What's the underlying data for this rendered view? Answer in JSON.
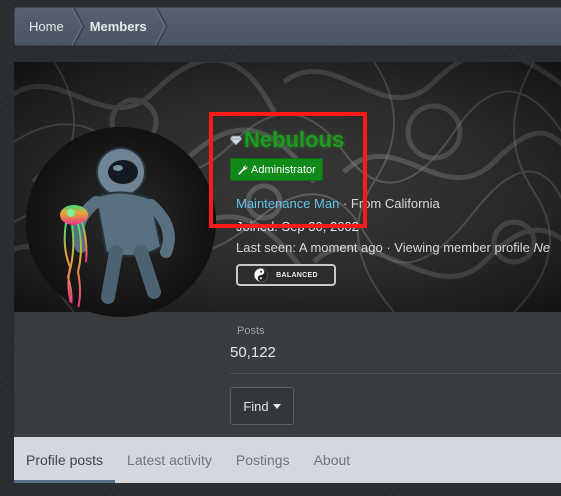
{
  "breadcrumb": {
    "home": "Home",
    "members": "Members"
  },
  "profile": {
    "username": "Nebulous",
    "badge": "Administrator",
    "title": "Maintenance Man",
    "location_prefix": "· From ",
    "location": "California",
    "joined_partial": "Joined: Sep 30, 2002",
    "last_seen_label": "Last seen:",
    "last_seen_value": "A moment ago",
    "activity": "· Viewing member profile",
    "activity_tail": "Ne",
    "balance_label": "BALANCED"
  },
  "stats": {
    "posts_label": "Posts",
    "posts_value": "50,122"
  },
  "actions": {
    "find_label": "Find"
  },
  "tabs": [
    {
      "label": "Profile posts"
    },
    {
      "label": "Latest activity"
    },
    {
      "label": "Postings"
    },
    {
      "label": "About"
    }
  ],
  "colors": {
    "username": "#1c9a24",
    "accent": "#62c4e8",
    "badge": "#118a1a",
    "highlight": "#ff1a1a"
  }
}
